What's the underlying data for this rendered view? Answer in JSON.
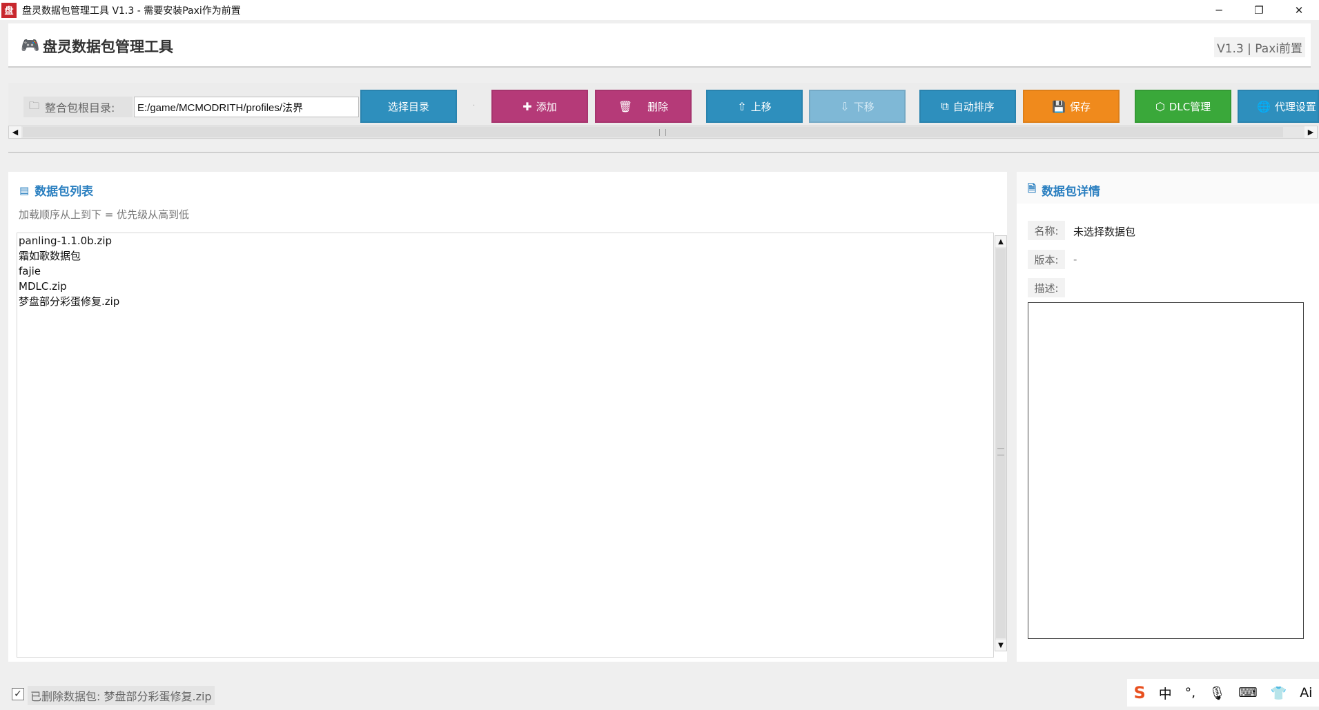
{
  "window": {
    "title": "盘灵数据包管理工具 V1.3 - 需要安装Paxi作为前置",
    "app_icon": "盘",
    "minimize": "─",
    "restore": "❐",
    "close": "✕"
  },
  "header": {
    "icon": "🎮",
    "title": "盘灵数据包管理工具",
    "version": "V1.3 | Paxi前置"
  },
  "toolbar": {
    "root_label": "整合包根目录:",
    "root_path": "E:/game/MCMODRITH/profiles/法界",
    "buttons": {
      "select_dir": "选择目录",
      "add": "添加",
      "delete": "删除",
      "move_up": "上移",
      "move_down": "下移",
      "auto_sort": "自动排序",
      "save": "保存",
      "dlc": "DLC管理",
      "proxy": "代理设置"
    },
    "colors": {
      "select_dir": "#2e8fbd",
      "add": "#b53a78",
      "delete": "#b53a78",
      "move_up": "#2e8fbd",
      "move_down": "#7fb8d6",
      "auto_sort": "#2e8fbd",
      "save": "#f08a1c",
      "dlc": "#3aa83a",
      "proxy": "#2e8fbd"
    }
  },
  "left_panel": {
    "title": "数据包列表",
    "hint": "加载顺序从上到下 = 优先级从高到低",
    "items": [
      "panling-1.1.0b.zip",
      "霜如歌数据包",
      "fajie",
      "MDLC.zip",
      "梦盘部分彩蛋修复.zip"
    ]
  },
  "right_panel": {
    "title": "数据包详情",
    "name_label": "名称:",
    "name_value": "未选择数据包",
    "version_label": "版本:",
    "version_value": "-",
    "desc_label": "描述:"
  },
  "status": {
    "text": "已删除数据包: 梦盘部分彩蛋修复.zip",
    "checked": true
  },
  "ime": {
    "logo": "S",
    "lang": "中"
  }
}
